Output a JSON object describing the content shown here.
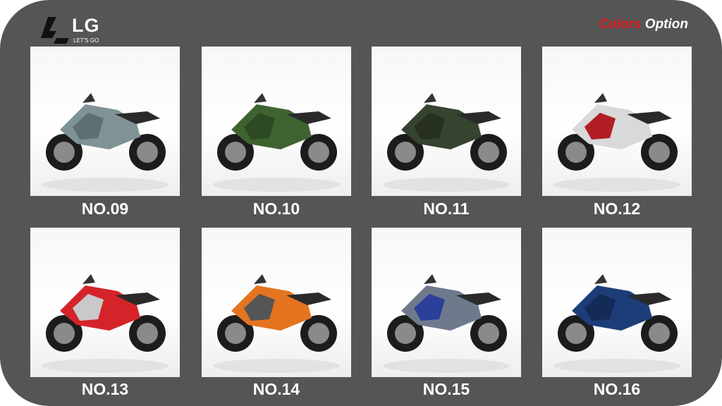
{
  "brand": {
    "name": "LG",
    "tagline": "LET'S GO"
  },
  "header": {
    "colors_word": "Colors",
    "option_word": "Option"
  },
  "bikes": [
    {
      "label": "NO.09",
      "color": "#7f9396",
      "accent": "#5d6f72"
    },
    {
      "label": "NO.10",
      "color": "#3f6330",
      "accent": "#2e4a23"
    },
    {
      "label": "NO.11",
      "color": "#36432e",
      "accent": "#262f20"
    },
    {
      "label": "NO.12",
      "color": "#d9d9d9",
      "accent": "#b11e24"
    },
    {
      "label": "NO.13",
      "color": "#d4242a",
      "accent": "#c9c9c9"
    },
    {
      "label": "NO.14",
      "color": "#e4741f",
      "accent": "#555555"
    },
    {
      "label": "NO.15",
      "color": "#6e7a8c",
      "accent": "#2c3f9a"
    },
    {
      "label": "NO.16",
      "color": "#1d3d78",
      "accent": "#142b58"
    }
  ],
  "colors": {
    "background": "#555555",
    "header_red": "#e0161b",
    "text": "#ffffff"
  }
}
